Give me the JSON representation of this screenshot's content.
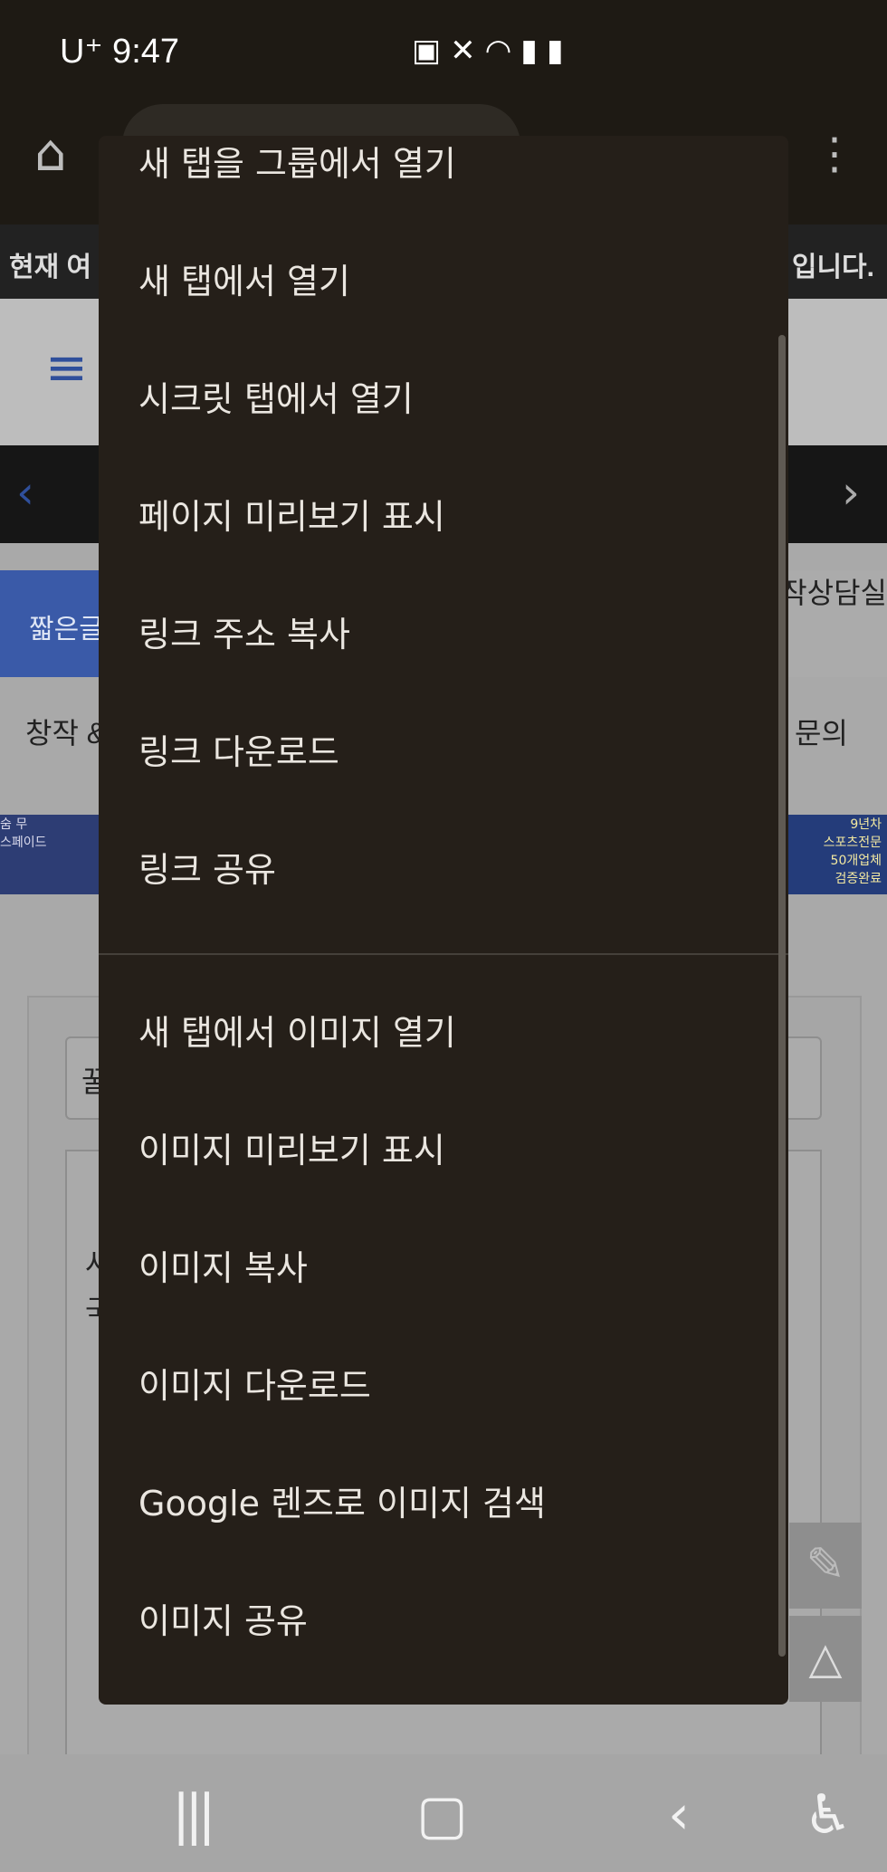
{
  "status_bar": {
    "time": "U⁺ 9:47",
    "icons": [
      "battery-saver-icon",
      "mute-icon",
      "wifi-icon",
      "signal-icon",
      "battery-icon"
    ]
  },
  "toolbar": {
    "home_icon": "home-icon",
    "menu_icon": "more-vertical-icon"
  },
  "page": {
    "notice_left": "현재 여",
    "notice_right": "입니다.",
    "tab_short": "짧은글",
    "tab_counsel": "창작상담실",
    "menu_left": "창작 &",
    "menu_right": "문의",
    "banner_left": "숨 무\n스페이드",
    "banner_right": "9년차\n스포츠전문\n50개업체\n검증완료",
    "input_text": "꿀",
    "content_text": "사\n국"
  },
  "context_menu": {
    "link_items": [
      "새 탭을 그룹에서 열기",
      "새 탭에서 열기",
      "시크릿 탭에서 열기",
      "페이지 미리보기 표시",
      "링크 주소 복사",
      "링크 다운로드",
      "링크 공유"
    ],
    "image_items": [
      "새 탭에서 이미지 열기",
      "이미지 미리보기 표시",
      "이미지 복사",
      "이미지 다운로드",
      "Google 렌즈로 이미지 검색",
      "이미지 공유"
    ]
  },
  "nav_bar": {
    "icons": [
      "recents-icon",
      "home-icon",
      "back-icon",
      "accessibility-icon"
    ]
  },
  "colors": {
    "menu_bg": "#251f19",
    "status_bg": "#1e1a14",
    "accent_blue": "#3a5aa8"
  }
}
